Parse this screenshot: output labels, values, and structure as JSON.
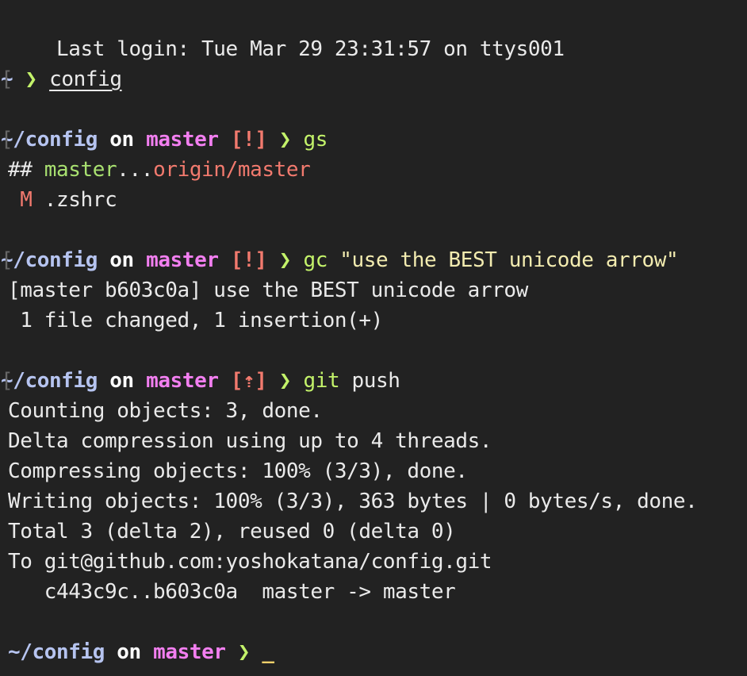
{
  "terminal": {
    "login_line": "Last login: Tue Mar 29 23:31:57 on ttys001",
    "left_bracket": "[",
    "prompt_arrow": "❯",
    "on_word": "on",
    "prompt1": {
      "dir": "~",
      "command": "config"
    },
    "prompt2": {
      "dir": "~/config",
      "branch": "master",
      "status": "[!]",
      "command": "gs"
    },
    "gs_output": {
      "prefix": "## ",
      "local": "master",
      "sep": "...",
      "remote": "origin/master",
      "modified_flag": "M",
      "modified_file": ".zshrc"
    },
    "prompt3": {
      "dir": "~/config",
      "branch": "master",
      "status": "[!]",
      "command": "gc",
      "argument": "\"use the BEST unicode arrow\""
    },
    "gc_output": [
      "[master b603c0a] use the BEST unicode arrow",
      " 1 file changed, 1 insertion(+)"
    ],
    "prompt4": {
      "dir": "~/config",
      "branch": "master",
      "status": "[⇡]",
      "command": "git",
      "argument": "push"
    },
    "push_output": [
      "Counting objects: 3, done.",
      "Delta compression using up to 4 threads.",
      "Compressing objects: 100% (3/3), done.",
      "Writing objects: 100% (3/3), 363 bytes | 0 bytes/s, done.",
      "Total 3 (delta 2), reused 0 (delta 0)",
      "To git@github.com:yoshokatana/config.git",
      "   c443c9c..b603c0a  master -> master"
    ],
    "prompt5": {
      "dir": "~/config",
      "branch": "master",
      "cursor": "_"
    }
  },
  "colors": {
    "background": "#222222",
    "directory": "#b6c4f0",
    "branch": "#f27ff0",
    "status": "#f27a6e",
    "prompt_arrow": "#c3f26a",
    "string": "#f3ecb0",
    "cursor": "#f3d06a"
  },
  "icons": {
    "prompt_arrow": "heavy-right-chevron-icon",
    "ahead_status": "up-arrow-icon"
  }
}
